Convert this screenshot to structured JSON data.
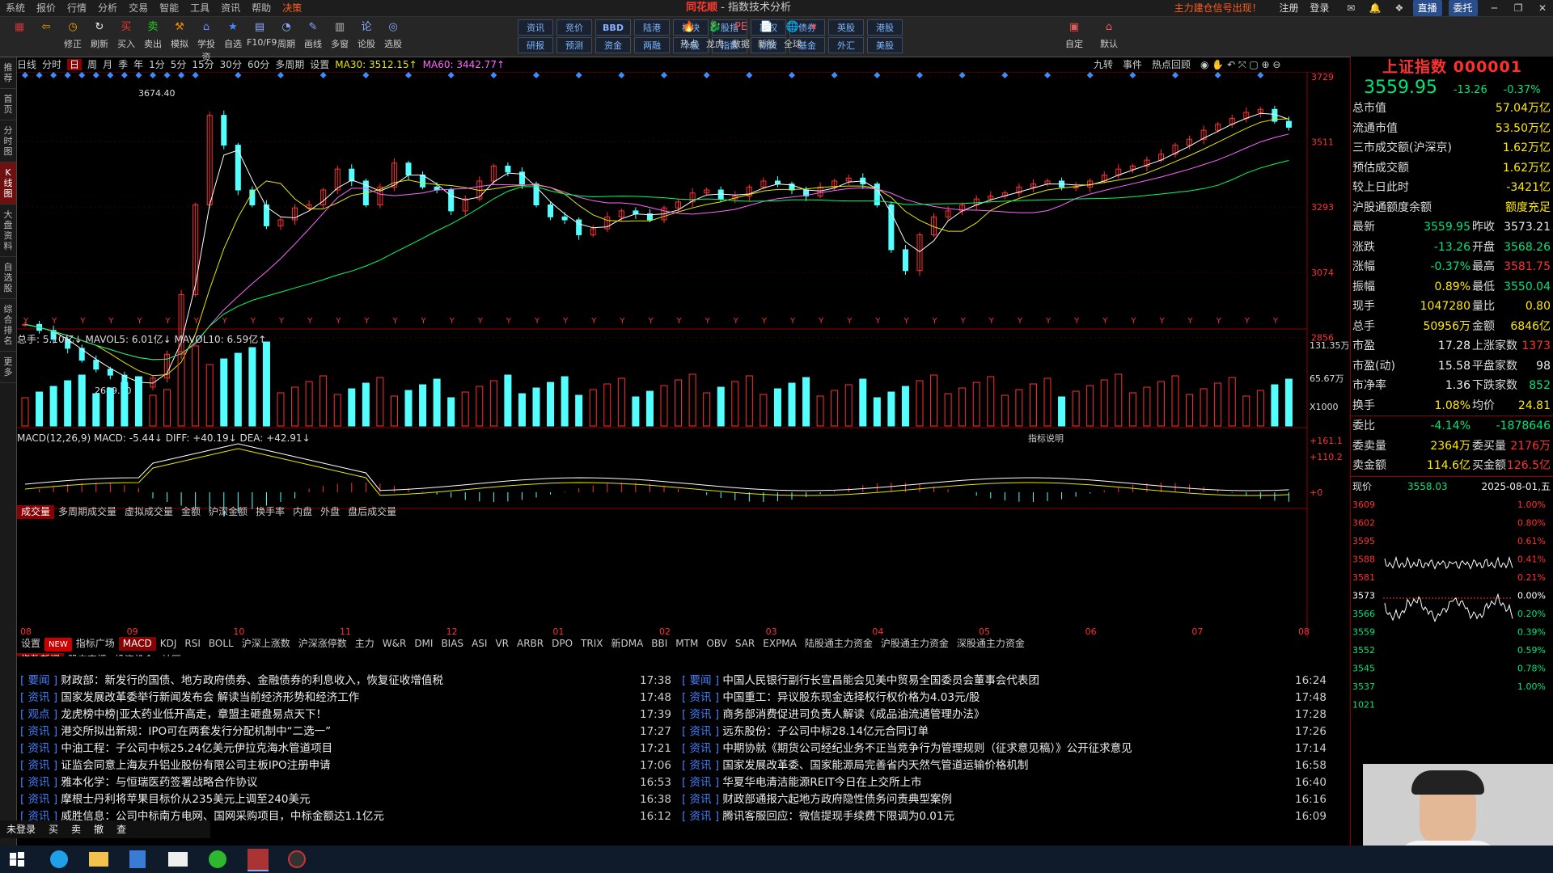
{
  "menu": [
    "系统",
    "报价",
    "行情",
    "分析",
    "交易",
    "智能",
    "工具",
    "资讯",
    "帮助",
    "决策"
  ],
  "app_title": {
    "brand": "同花顺",
    "sep": "-",
    "view": "指数技术分析"
  },
  "top_right": {
    "promo": "主力建仓信号出现！",
    "register": "注册",
    "login": "登录",
    "live": "直播",
    "agent": "委托"
  },
  "toolbar": [
    "",
    "",
    "修正",
    "刷新",
    "买入",
    "卖出",
    "模拟",
    "学投资",
    "自选",
    "F10/F9",
    "周期",
    "画线",
    "多窗",
    "论股",
    "选股"
  ],
  "quick_top": [
    "资讯",
    "竞价",
    "BBD",
    "陆港",
    "板块",
    "股指",
    "期权",
    "债券",
    "英股",
    "港股"
  ],
  "quick_bot": [
    "研报",
    "预测",
    "资金",
    "两融",
    "个股",
    "指数",
    "期货",
    "基金",
    "外汇",
    "美股"
  ],
  "tool_right": [
    "热点",
    "龙虎",
    "数据",
    "新股",
    "全球",
    "",
    "自定",
    "默认"
  ],
  "left_tabs": [
    "推荐",
    "首页",
    "分时图",
    "K线图",
    "大盘资料",
    "自选股",
    "综合排名",
    "更多"
  ],
  "period_bar": {
    "items": [
      "日线",
      "分时",
      "日",
      "周",
      "月",
      "季",
      "年",
      "1分",
      "5分",
      "15分",
      "30分",
      "60分",
      "多周期",
      "设置"
    ],
    "active": "日",
    "ma30": "MA30: 3512.15↑",
    "ma60": "MA60: 3442.77↑"
  },
  "chart_right_btns": [
    "九转",
    "事件",
    "热点回顾"
  ],
  "chart_data": {
    "type": "candlestick",
    "title": "上证指数 000001",
    "x_ticks": [
      "08",
      "09",
      "10",
      "11",
      "12",
      "01",
      "02",
      "03",
      "04",
      "05",
      "06",
      "07",
      "08"
    ],
    "y_ticks": [
      3729,
      3511,
      3293,
      3074,
      2856
    ],
    "annotations": {
      "high": "3674.40",
      "low": "2689.70"
    },
    "series_close_approx": [
      2900,
      2880,
      2850,
      2820,
      2780,
      2750,
      2730,
      2700,
      2690,
      2720,
      2800,
      3000,
      3300,
      3600,
      3500,
      3350,
      3300,
      3230,
      3250,
      3290,
      3300,
      3350,
      3420,
      3380,
      3300,
      3360,
      3440,
      3400,
      3360,
      3350,
      3280,
      3320,
      3380,
      3430,
      3410,
      3370,
      3300,
      3260,
      3250,
      3200,
      3220,
      3260,
      3280,
      3270,
      3250,
      3290,
      3310,
      3340,
      3350,
      3320,
      3330,
      3360,
      3380,
      3370,
      3350,
      3330,
      3360,
      3380,
      3390,
      3370,
      3300,
      3150,
      3080,
      3200,
      3260,
      3280,
      3300,
      3320,
      3330,
      3340,
      3360,
      3370,
      3380,
      3360,
      3360,
      3380,
      3400,
      3420,
      3430,
      3450,
      3470,
      3500,
      3520,
      3550,
      3570,
      3590,
      3610,
      3620,
      3580,
      3560
    ]
  },
  "volume_panel": {
    "label": "总手: 5.10亿↓ MAVOL5: 6.01亿↓ MAVOL10: 6.59亿↑",
    "ticks": [
      "131.35万",
      "65.67万",
      "X1000"
    ]
  },
  "vol_tabs": {
    "items": [
      "成交量",
      "多周期成交量",
      "虚拟成交量",
      "金额",
      "沪深金额",
      "换手率",
      "内盘",
      "外盘",
      "盘后成交量"
    ],
    "active": "成交量"
  },
  "macd_panel": {
    "label": "MACD(12,26,9) MACD: -5.44↓ DIFF: +40.19↓ DEA: +42.91↓",
    "explain": "指标说明",
    "ticks": [
      "+161.1",
      "+110.2",
      "+0"
    ]
  },
  "ind_tabs": {
    "items": [
      "设置",
      "NEW",
      "指标广场",
      "MACD",
      "KDJ",
      "RSI",
      "BOLL",
      "沪深上涨数",
      "沪深涨停数",
      "主力",
      "W&R",
      "DMI",
      "BIAS",
      "ASI",
      "VR",
      "ARBR",
      "DPO",
      "TRIX",
      "新DMA",
      "BBI",
      "MTM",
      "OBV",
      "SAR",
      "EXPMA",
      "陆股通主力资金",
      "沪股通主力资金",
      "深股通主力资金"
    ],
    "active": "MACD"
  },
  "news_tabs": {
    "items": [
      "指数新闻",
      "股市直播",
      "投资机会",
      "社区"
    ],
    "active": "指数新闻"
  },
  "news_left": [
    {
      "tag": "[ 要闻 ]",
      "title": "财政部：新发行的国债、地方政府债券、金融债券的利息收入，恢复征收增值税",
      "time": "17:38"
    },
    {
      "tag": "[ 资讯 ]",
      "title": "国家发展改革委举行新闻发布会 解读当前经济形势和经济工作",
      "time": "17:48"
    },
    {
      "tag": "[ 观点 ]",
      "title": "龙虎榜中榜|亚太药业低开高走，章盟主砸盘易点天下！",
      "time": "17:39"
    },
    {
      "tag": "[ 资讯 ]",
      "title": "港交所拟出新规：IPO可在两套发行分配机制中“二选一”",
      "time": "17:27"
    },
    {
      "tag": "[ 资讯 ]",
      "title": "中油工程：子公司中标25.24亿美元伊拉克海水管道项目",
      "time": "17:21"
    },
    {
      "tag": "[ 资讯 ]",
      "title": "证监会同意上海友升铝业股份有限公司主板IPO注册申请",
      "time": "17:06"
    },
    {
      "tag": "[ 资讯 ]",
      "title": "雅本化学：与恒瑞医药签署战略合作协议",
      "time": "16:53"
    },
    {
      "tag": "[ 资讯 ]",
      "title": "摩根士丹利将苹果目标价从235美元上调至240美元",
      "time": "16:38"
    },
    {
      "tag": "[ 资讯 ]",
      "title": "威胜信息：公司中标南方电网、国网采购项目，中标金额达1.1亿元",
      "time": "16:12"
    }
  ],
  "news_right": [
    {
      "tag": "[ 要闻 ]",
      "title": "中国人民银行副行长宣昌能会见美中贸易全国委员会董事会代表团",
      "time": "16:24"
    },
    {
      "tag": "[ 资讯 ]",
      "title": "中国重工：异议股东现金选择权行权价格为4.03元/股",
      "time": "17:48"
    },
    {
      "tag": "[ 资讯 ]",
      "title": "商务部消费促进司负责人解读《成品油流通管理办法》",
      "time": "17:28"
    },
    {
      "tag": "[ 资讯 ]",
      "title": "远东股份：子公司中标28.14亿元合同订单",
      "time": "17:26"
    },
    {
      "tag": "[ 资讯 ]",
      "title": "中期协就《期货公司经纪业务不正当竞争行为管理规则（征求意见稿）》公开征求意见",
      "time": "17:14"
    },
    {
      "tag": "[ 资讯 ]",
      "title": "国家发展改革委、国家能源局完善省内天然气管道运输价格机制",
      "time": "16:58"
    },
    {
      "tag": "[ 资讯 ]",
      "title": "华夏华电清洁能源REIT今日在上交所上市",
      "time": "16:40"
    },
    {
      "tag": "[ 资讯 ]",
      "title": "财政部通报六起地方政府隐性债务问责典型案例",
      "time": "16:16"
    },
    {
      "tag": "[ 资讯 ]",
      "title": "腾讯客服回应：微信提现手续费下限调为0.01元",
      "time": "16:09"
    }
  ],
  "quote": {
    "name": "上证指数 000001",
    "price": "3559.95",
    "change": "-13.26",
    "pct": "-0.37%",
    "rows1": [
      {
        "k": "总市值",
        "v": "57.04万亿",
        "c": "yel"
      },
      {
        "k": "流通市值",
        "v": "53.50万亿",
        "c": "yel"
      },
      {
        "k": "三市成交额(沪深京)",
        "v": "1.62万亿",
        "c": "yel"
      },
      {
        "k": "预估成交额",
        "v": "1.62万亿",
        "c": "yel"
      },
      {
        "k": "较上日此时",
        "v": "-3421亿",
        "c": "yel"
      },
      {
        "k": "沪股通额度余额",
        "v": "额度充足",
        "c": "yel"
      }
    ],
    "rows2": [
      {
        "k1": "最新",
        "v1": "3559.95",
        "c1": "grn",
        "k2": "昨收",
        "v2": "3573.21",
        "c2": "wht"
      },
      {
        "k1": "涨跌",
        "v1": "-13.26",
        "c1": "grn",
        "k2": "开盘",
        "v2": "3568.26",
        "c2": "grn"
      },
      {
        "k1": "涨幅",
        "v1": "-0.37%",
        "c1": "grn",
        "k2": "最高",
        "v2": "3581.75",
        "c2": "red"
      },
      {
        "k1": "振幅",
        "v1": "0.89%",
        "c1": "yel",
        "k2": "最低",
        "v2": "3550.04",
        "c2": "grn"
      },
      {
        "k1": "现手",
        "v1": "1047280",
        "c1": "yel",
        "k2": "量比",
        "v2": "0.80",
        "c2": "yel"
      },
      {
        "k1": "总手",
        "v1": "50956万",
        "c1": "yel",
        "k2": "金额",
        "v2": "6846亿",
        "c2": "yel"
      },
      {
        "k1": "市盈",
        "v1": "17.28",
        "c1": "wht",
        "k2": "上涨家数",
        "v2": "1373",
        "c2": "red"
      },
      {
        "k1": "市盈(动)",
        "v1": "15.58",
        "c1": "wht",
        "k2": "平盘家数",
        "v2": "98",
        "c2": "wht"
      },
      {
        "k1": "市净率",
        "v1": "1.36",
        "c1": "wht",
        "k2": "下跌家数",
        "v2": "852",
        "c2": "grn"
      },
      {
        "k1": "换手",
        "v1": "1.08%",
        "c1": "yel",
        "k2": "均价",
        "v2": "24.81",
        "c2": "yel"
      }
    ],
    "weibi": {
      "k": "委比",
      "v": "-4.14%",
      "k2": "",
      "v2": "-1878646"
    },
    "ww": [
      {
        "k1": "委卖量",
        "v1": "2364万",
        "k2": "委买量",
        "v2": "2176万"
      },
      {
        "k1": "卖金额",
        "v1": "114.6亿",
        "k2": "买金额",
        "v2": "126.5亿"
      }
    ],
    "now": {
      "k": "现价",
      "v": "3558.03",
      "date": "2025-08-01,五"
    },
    "mini_ticks": [
      "3609",
      "3602",
      "3595",
      "3588",
      "3581",
      "3573",
      "3566",
      "3559",
      "3552",
      "3545",
      "3537",
      "1021"
    ],
    "mini_pct": [
      "1.00%",
      "0.80%",
      "0.61%",
      "0.41%",
      "0.21%",
      "0.00%",
      "0.20%",
      "0.39%",
      "0.59%",
      "0.78%",
      "1.00%"
    ]
  },
  "status": {
    "items": [
      "未登录",
      "买",
      "卖",
      "撤",
      "查",
      "",
      "",
      ""
    ]
  }
}
